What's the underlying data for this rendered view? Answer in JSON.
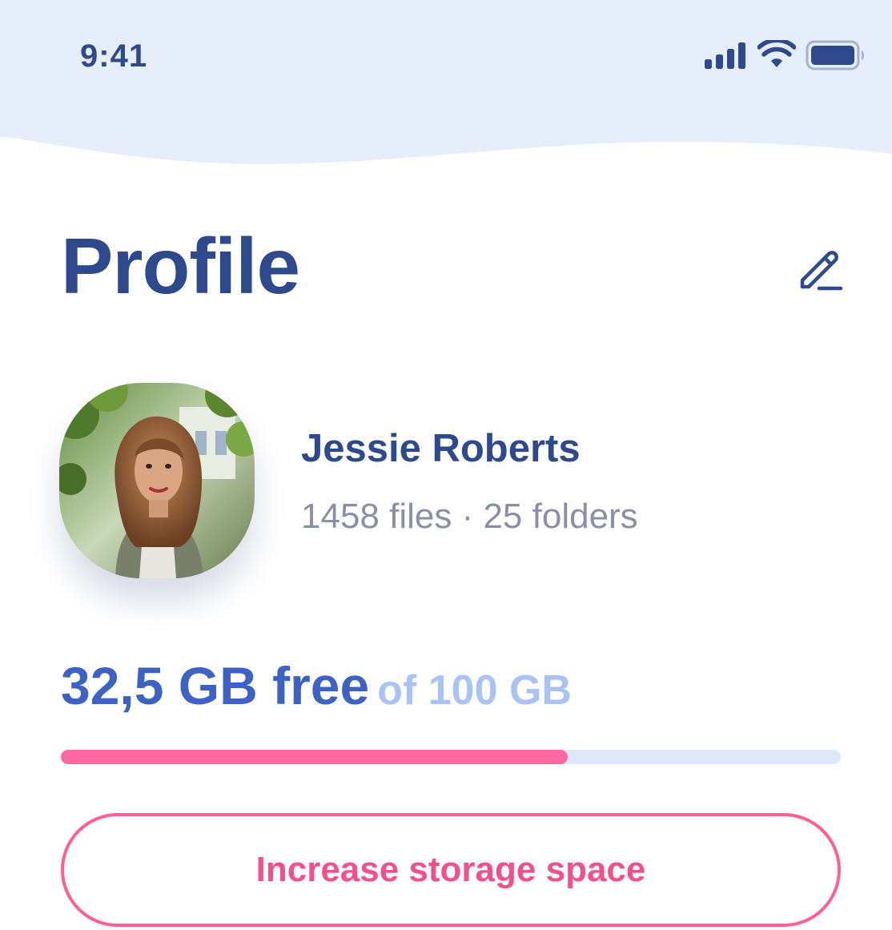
{
  "status_bar": {
    "time": "9:41",
    "icons": [
      "signal-icon",
      "wifi-icon",
      "battery-icon"
    ]
  },
  "header": {
    "title": "Profile",
    "edit_icon": "pencil-icon"
  },
  "profile": {
    "name": "Jessie Roberts",
    "meta": "1458 files · 25 folders"
  },
  "storage": {
    "free_label": "32,5 GB free",
    "total_label": "of 100 GB",
    "used_fraction": 0.65
  },
  "actions": {
    "increase_label": "Increase storage space"
  },
  "colors": {
    "primary": "#2f4a8c",
    "accent_blue": "#3d62c4",
    "light_blue": "#a9c3f5",
    "header_bg": "#e6eefc",
    "pink": "#ff5f96",
    "muted_text": "#8a90a3"
  }
}
